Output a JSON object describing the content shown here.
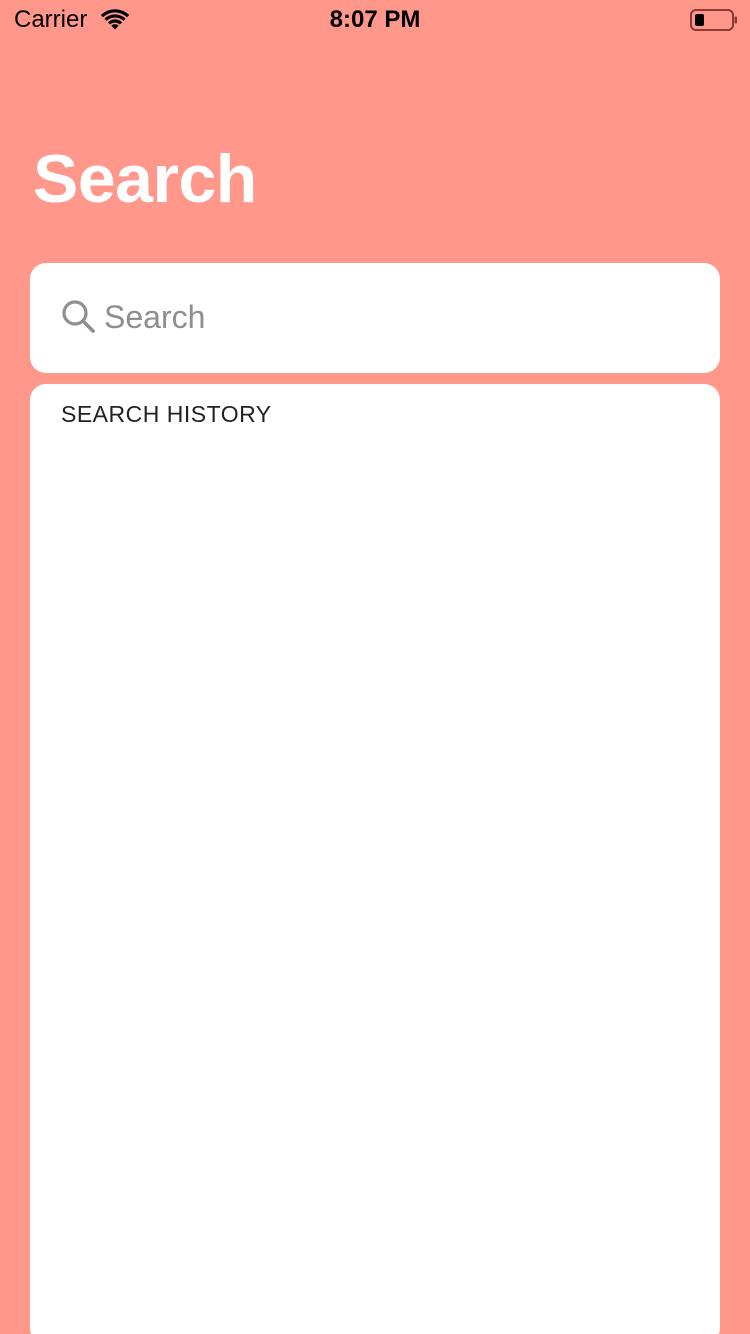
{
  "status_bar": {
    "carrier": "Carrier",
    "time": "8:07 PM",
    "wifi_icon": "wifi-icon",
    "battery_icon": "battery-icon"
  },
  "header": {
    "title": "Search"
  },
  "search": {
    "placeholder": "Search",
    "value": "",
    "icon": "search-icon"
  },
  "history": {
    "header": "SEARCH HISTORY",
    "items": []
  },
  "colors": {
    "background": "#FF978A",
    "card": "#FFFFFF",
    "title": "#FFFFFF",
    "placeholder": "#8E8E93"
  }
}
